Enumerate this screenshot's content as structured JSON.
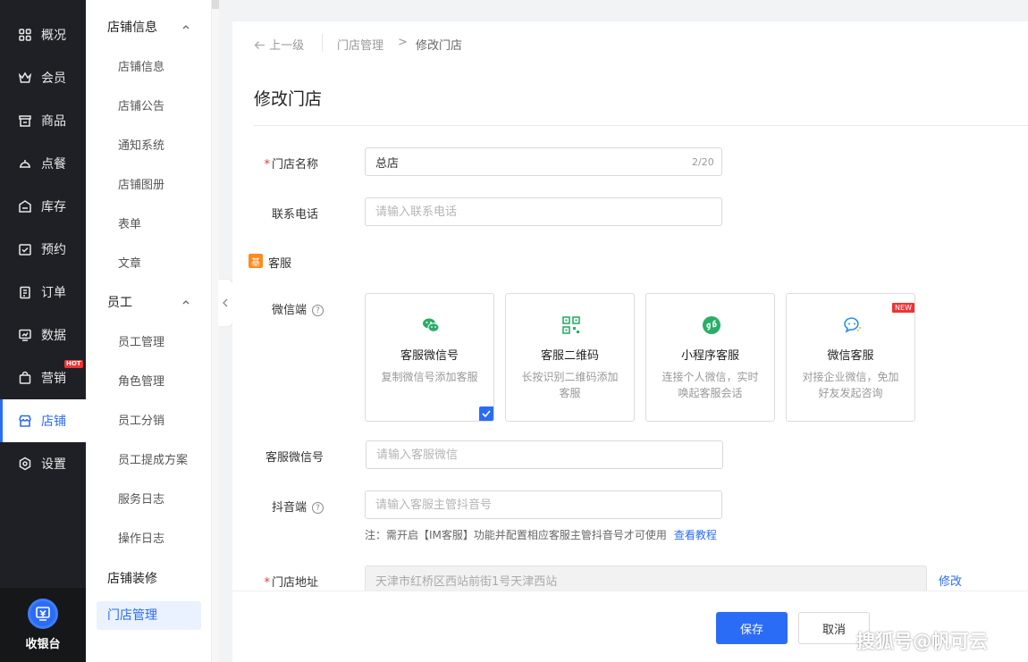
{
  "nav": {
    "items": [
      {
        "label": "概况",
        "icon": "grid-icon"
      },
      {
        "label": "会员",
        "icon": "crown-icon"
      },
      {
        "label": "商品",
        "icon": "shop-icon"
      },
      {
        "label": "点餐",
        "icon": "dish-icon"
      },
      {
        "label": "库存",
        "icon": "inventory-icon"
      },
      {
        "label": "预约",
        "icon": "calendar-check-icon"
      },
      {
        "label": "订单",
        "icon": "clipboard-icon"
      },
      {
        "label": "数据",
        "icon": "monitor-chart-icon"
      },
      {
        "label": "营销",
        "icon": "bag-icon",
        "badge": "HOT"
      },
      {
        "label": "店铺",
        "icon": "store-icon",
        "active": true
      },
      {
        "label": "设置",
        "icon": "settings-icon"
      }
    ],
    "cashier": "收银台",
    "active_color": "#2b6cf6"
  },
  "submenu": {
    "group1": "店铺信息",
    "group1_items": [
      "店铺信息",
      "店铺公告",
      "通知系统",
      "店铺图册",
      "表单",
      "文章"
    ],
    "group2": "员工",
    "group2_items": [
      "员工管理",
      "角色管理",
      "员工分销",
      "员工提成方案",
      "服务日志",
      "操作日志"
    ],
    "group3": "店铺装修",
    "active": "门店管理"
  },
  "breadcrumb": {
    "back": "上一级",
    "parent": "门店管理",
    "separator": ">",
    "current": "修改门店"
  },
  "page_title": "修改门店",
  "form": {
    "store_name": {
      "label": "门店名称",
      "value": "总店",
      "counter": "2/20",
      "required": true
    },
    "phone": {
      "label": "联系电话",
      "placeholder": "请输入联系电话"
    },
    "section": {
      "badge": "基",
      "title": "客服"
    },
    "wechat": {
      "label": "微信端",
      "help": "?"
    },
    "cards": [
      {
        "title": "客服微信号",
        "desc": "复制微信号添加客服",
        "icon": "wechat-icon",
        "selected": true
      },
      {
        "title": "客服二维码",
        "desc": "长按识别二维码添加客服",
        "icon": "qrcode-icon"
      },
      {
        "title": "小程序客服",
        "desc": "连接个人微信，实时唤起客服会话",
        "icon": "miniprogram-icon"
      },
      {
        "title": "微信客服",
        "desc": "对接企业微信，免加好友发起咨询",
        "icon": "chat-bubble-icon",
        "badge": "NEW"
      }
    ],
    "wechat_id": {
      "label": "客服微信号",
      "placeholder": "请输入客服微信"
    },
    "douyin": {
      "label": "抖音端",
      "help": "?",
      "placeholder": "请输入客服主管抖音号"
    },
    "note": "注：需开启【IM客服】功能并配置相应客服主管抖音号才可使用",
    "note_link": "查看教程",
    "address": {
      "label": "门店地址",
      "value": "天津市红桥区西站前街1号天津西站",
      "required": true,
      "edit": "修改"
    }
  },
  "footer": {
    "save": "保存",
    "cancel": "取消"
  },
  "watermark": "搜狐号@帆可云"
}
